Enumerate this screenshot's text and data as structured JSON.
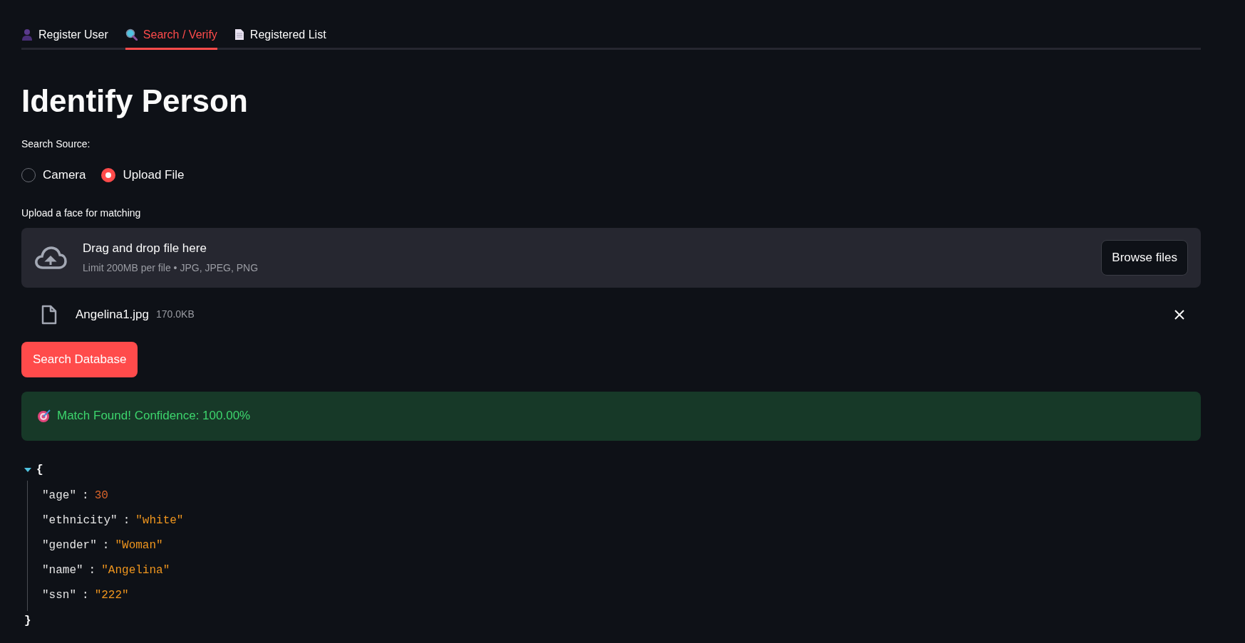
{
  "tabs": [
    {
      "label": "Register User",
      "kind": "person",
      "selected": false
    },
    {
      "label": "Search / Verify",
      "kind": "search",
      "selected": true
    },
    {
      "label": "Registered List",
      "kind": "document",
      "selected": false
    }
  ],
  "title": "Identify Person",
  "source": {
    "label": "Search Source:",
    "options": [
      {
        "label": "Camera",
        "selected": false
      },
      {
        "label": "Upload File",
        "selected": true
      }
    ]
  },
  "uploader": {
    "label": "Upload a face for matching",
    "drop_text": "Drag and drop file here",
    "limit_text": "Limit 200MB per file • JPG, JPEG, PNG",
    "browse_button": "Browse files",
    "file": {
      "name": "Angelina1.jpg",
      "size": "170.0KB"
    }
  },
  "search_button": "Search Database",
  "alert": {
    "text": "Match Found! Confidence: 100.00%"
  },
  "result": {
    "expanded": true,
    "open": "{",
    "close": "}",
    "entries": [
      {
        "key": "\"age\"",
        "separator": ":",
        "value": "30",
        "kind": "number"
      },
      {
        "key": "\"ethnicity\"",
        "separator": ":",
        "value": "\"white\"",
        "kind": "string"
      },
      {
        "key": "\"gender\"",
        "separator": ":",
        "value": "\"Woman\"",
        "kind": "string"
      },
      {
        "key": "\"name\"",
        "separator": ":",
        "value": "\"Angelina\"",
        "kind": "string"
      },
      {
        "key": "\"ssn\"",
        "separator": ":",
        "value": "\"222\"",
        "kind": "string"
      }
    ]
  }
}
